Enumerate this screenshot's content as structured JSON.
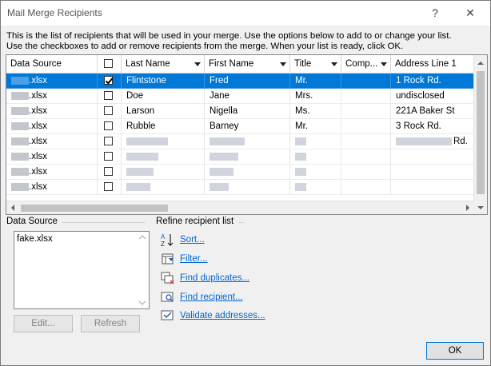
{
  "window": {
    "title": "Mail Merge Recipients",
    "help_symbol": "?",
    "close_symbol": "✕"
  },
  "intro": {
    "line1": "This is the list of recipients that will be used in your merge.  Use the options below to add to or change your list.",
    "line2": "Use the checkboxes to add or remove recipients from the merge.  When your list is ready, click OK."
  },
  "grid": {
    "columns": [
      "Data Source",
      "",
      "Last Name",
      "First Name",
      "Title",
      "Comp...",
      "Address Line 1"
    ],
    "rows": [
      {
        "source": ".xlsx",
        "checked": true,
        "last": "Flintstone",
        "first": "Fred",
        "title": "Mr.",
        "company": "",
        "address": "1 Rock Rd.",
        "selected": true
      },
      {
        "source": ".xlsx",
        "checked": false,
        "last": "Doe",
        "first": "Jane",
        "title": "Mrs.",
        "company": "",
        "address": "undisclosed",
        "selected": false
      },
      {
        "source": ".xlsx",
        "checked": false,
        "last": "Larson",
        "first": "Nigella",
        "title": "Ms.",
        "company": "",
        "address": "221A Baker St",
        "selected": false
      },
      {
        "source": ".xlsx",
        "checked": false,
        "last": "Rubble",
        "first": "Barney",
        "title": "Mr.",
        "company": "",
        "address": "3 Rock Rd.",
        "selected": false
      },
      {
        "source": ".xlsx",
        "checked": false,
        "last": "",
        "first": "",
        "title": "",
        "company": "",
        "address": "Rd.",
        "selected": false
      },
      {
        "source": ".xlsx",
        "checked": false,
        "last": "",
        "first": "",
        "title": "",
        "company": "",
        "address": "",
        "selected": false
      },
      {
        "source": ".xlsx",
        "checked": false,
        "last": "",
        "first": "",
        "title": "",
        "company": "",
        "address": "",
        "selected": false
      },
      {
        "source": ".xlsx",
        "checked": false,
        "last": "",
        "first": "",
        "title": "",
        "company": "",
        "address": "",
        "selected": false
      }
    ]
  },
  "data_source": {
    "label": "Data Source",
    "items": [
      "fake.xlsx"
    ],
    "edit_button": "Edit...",
    "refresh_button": "Refresh"
  },
  "refine": {
    "label": "Refine recipient list",
    "links": [
      "Sort...",
      "Filter...",
      "Find duplicates...",
      "Find recipient...",
      "Validate addresses..."
    ]
  },
  "ok_button": "OK",
  "colors": {
    "selection": "#0078d7",
    "link": "#0066cc"
  }
}
